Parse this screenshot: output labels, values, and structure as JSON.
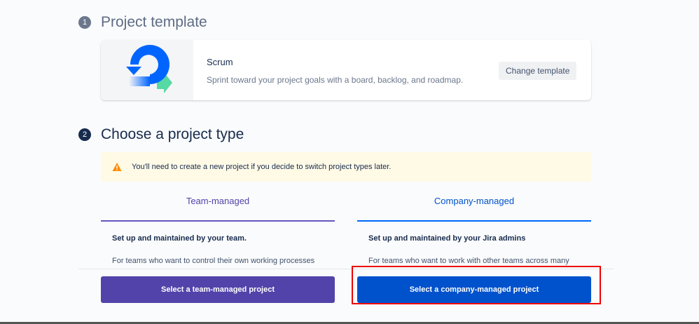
{
  "step1": {
    "number": "1",
    "title": "Project template"
  },
  "template": {
    "name": "Scrum",
    "description": "Sprint toward your project goals with a board, backlog, and roadmap.",
    "change_label": "Change template"
  },
  "step2": {
    "number": "2",
    "title": "Choose a project type"
  },
  "warning": {
    "text": "You'll need to create a new project if you decide to switch project types later."
  },
  "team": {
    "tab": "Team-managed",
    "subtitle": "Set up and maintained by your team.",
    "text": "For teams who want to control their own working processes",
    "button": "Select a team-managed project",
    "color": "#5243aa"
  },
  "company": {
    "tab": "Company-managed",
    "subtitle": "Set up and maintained by your Jira admins",
    "text": "For teams who want to work with other teams across many",
    "button": "Select a company-managed project",
    "color": "#0052cc"
  }
}
